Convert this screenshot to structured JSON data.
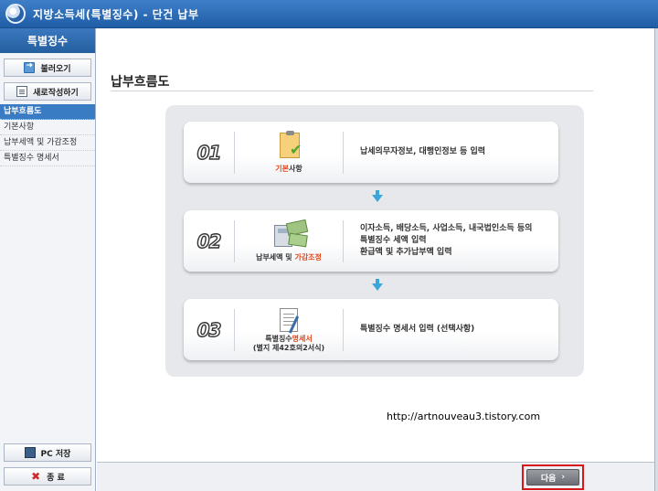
{
  "window": {
    "title": "지방소득세(특별징수) - 단건 납부"
  },
  "sidebar": {
    "header": "특별징수",
    "load_button": "불러오기",
    "new_button": "새로작성하기",
    "menu": [
      {
        "label": "납부흐름도",
        "active": true
      },
      {
        "label": "기본사항",
        "active": false
      },
      {
        "label": "납부세액 및 가감조정",
        "active": false
      },
      {
        "label": "특별징수 명세서",
        "active": false
      }
    ],
    "pc_save_button": "PC 저장",
    "exit_button": "종 료"
  },
  "main": {
    "page_title": "납부흐름도",
    "steps": [
      {
        "number": "01",
        "label_highlight": "기본",
        "label_rest": "사항",
        "desc_lines": [
          "납세의무자정보, 대행인정보 등 입력"
        ]
      },
      {
        "number": "02",
        "label_plain": "납부세액 및 ",
        "label_highlight": "가감조정",
        "desc_lines": [
          "이자소득, 배당소득, 사업소득, 내국법인소득 등의",
          "특별징수 세액 입력",
          "환급액 및 추가납부액 입력"
        ]
      },
      {
        "number": "03",
        "label_plain": "특별징수",
        "label_highlight": "명세서",
        "label_sub": "(별지 제42호의2서식)",
        "desc_lines": [
          "특별징수 명세서 입력 (선택사항)"
        ]
      }
    ],
    "watermark": "http://artnouveau3.tistory.com"
  },
  "footer": {
    "next_button": "다음",
    "next_glyph": "›"
  },
  "colors": {
    "accent": "#3a7cc4",
    "highlight": "#e2471b",
    "next_outline": "#d81818"
  }
}
